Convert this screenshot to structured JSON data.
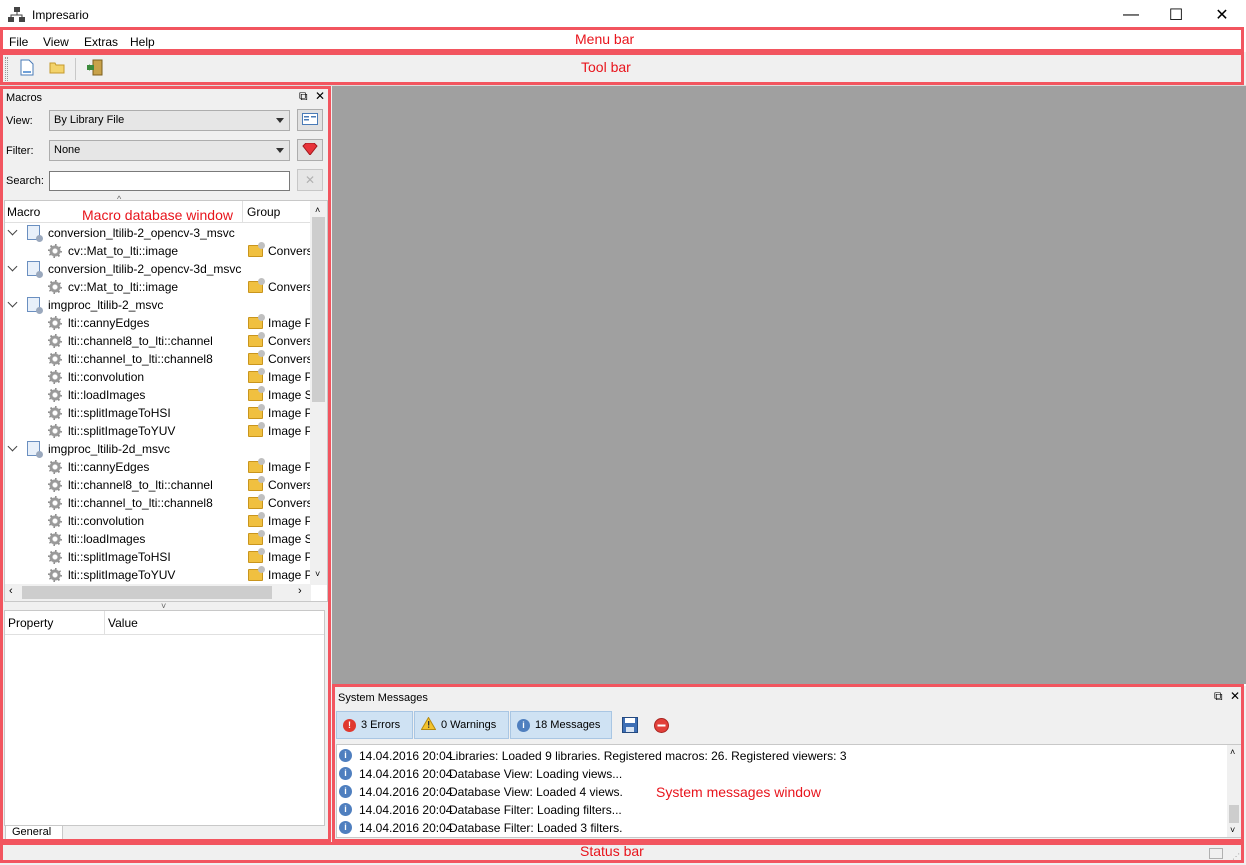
{
  "window": {
    "title": "Impresario",
    "minimize": "—",
    "maximize": "☐",
    "close": "✕"
  },
  "menu": {
    "items": [
      "File",
      "View",
      "Extras",
      "Help"
    ]
  },
  "macros_dock": {
    "title": "Macros",
    "view_label": "View:",
    "view_value": "By Library File",
    "filter_label": "Filter:",
    "filter_value": "None",
    "search_label": "Search:",
    "search_value": "",
    "col_macro": "Macro",
    "col_group": "Group",
    "rows": [
      {
        "kind": "lib",
        "text": "conversion_ltilib-2_opencv-3_msvc",
        "group": ""
      },
      {
        "kind": "macro",
        "text": "cv::Mat_to_lti::image",
        "group": "Convers"
      },
      {
        "kind": "lib",
        "text": "conversion_ltilib-2_opencv-3d_msvc",
        "group": ""
      },
      {
        "kind": "macro",
        "text": "cv::Mat_to_lti::image",
        "group": "Convers"
      },
      {
        "kind": "lib",
        "text": "imgproc_ltilib-2_msvc",
        "group": ""
      },
      {
        "kind": "macro",
        "text": "lti::cannyEdges",
        "group": "Image P"
      },
      {
        "kind": "macro",
        "text": "lti::channel8_to_lti::channel",
        "group": "Convers"
      },
      {
        "kind": "macro",
        "text": "lti::channel_to_lti::channel8",
        "group": "Convers"
      },
      {
        "kind": "macro",
        "text": "lti::convolution",
        "group": "Image P"
      },
      {
        "kind": "macro",
        "text": "lti::loadImages",
        "group": "Image So"
      },
      {
        "kind": "macro",
        "text": "lti::splitImageToHSI",
        "group": "Image P"
      },
      {
        "kind": "macro",
        "text": "lti::splitImageToYUV",
        "group": "Image P"
      },
      {
        "kind": "lib",
        "text": "imgproc_ltilib-2d_msvc",
        "group": ""
      },
      {
        "kind": "macro",
        "text": "lti::cannyEdges",
        "group": "Image P"
      },
      {
        "kind": "macro",
        "text": "lti::channel8_to_lti::channel",
        "group": "Convers"
      },
      {
        "kind": "macro",
        "text": "lti::channel_to_lti::channel8",
        "group": "Convers"
      },
      {
        "kind": "macro",
        "text": "lti::convolution",
        "group": "Image P"
      },
      {
        "kind": "macro",
        "text": "lti::loadImages",
        "group": "Image So"
      },
      {
        "kind": "macro",
        "text": "lti::splitImageToHSI",
        "group": "Image P"
      },
      {
        "kind": "macro",
        "text": "lti::splitImageToYUV",
        "group": "Image P"
      }
    ],
    "col_property": "Property",
    "col_value": "Value",
    "tab_general": "General"
  },
  "system_messages": {
    "title": "System Messages",
    "errors_tab": "3 Errors",
    "warnings_tab": "0 Warnings",
    "messages_tab": "18 Messages",
    "rows": [
      {
        "time": "14.04.2016 20:04",
        "text": "Libraries: Loaded 9 libraries. Registered macros: 26. Registered viewers: 3"
      },
      {
        "time": "14.04.2016 20:04",
        "text": "Database View: Loading views..."
      },
      {
        "time": "14.04.2016 20:04",
        "text": "Database View: Loaded 4 views."
      },
      {
        "time": "14.04.2016 20:04",
        "text": "Database Filter: Loading filters..."
      },
      {
        "time": "14.04.2016 20:04",
        "text": "Database Filter: Loaded 3 filters."
      }
    ]
  },
  "annotations": {
    "menu_bar": "Menu bar",
    "tool_bar": "Tool bar",
    "macro_db": "Macro database window",
    "sys_msg": "System messages window",
    "status_bar": "Status bar"
  },
  "colors": {
    "annotation": "#f2555f",
    "workspace": "#a0a0a0",
    "tab_blue": "#cfe2f3"
  }
}
